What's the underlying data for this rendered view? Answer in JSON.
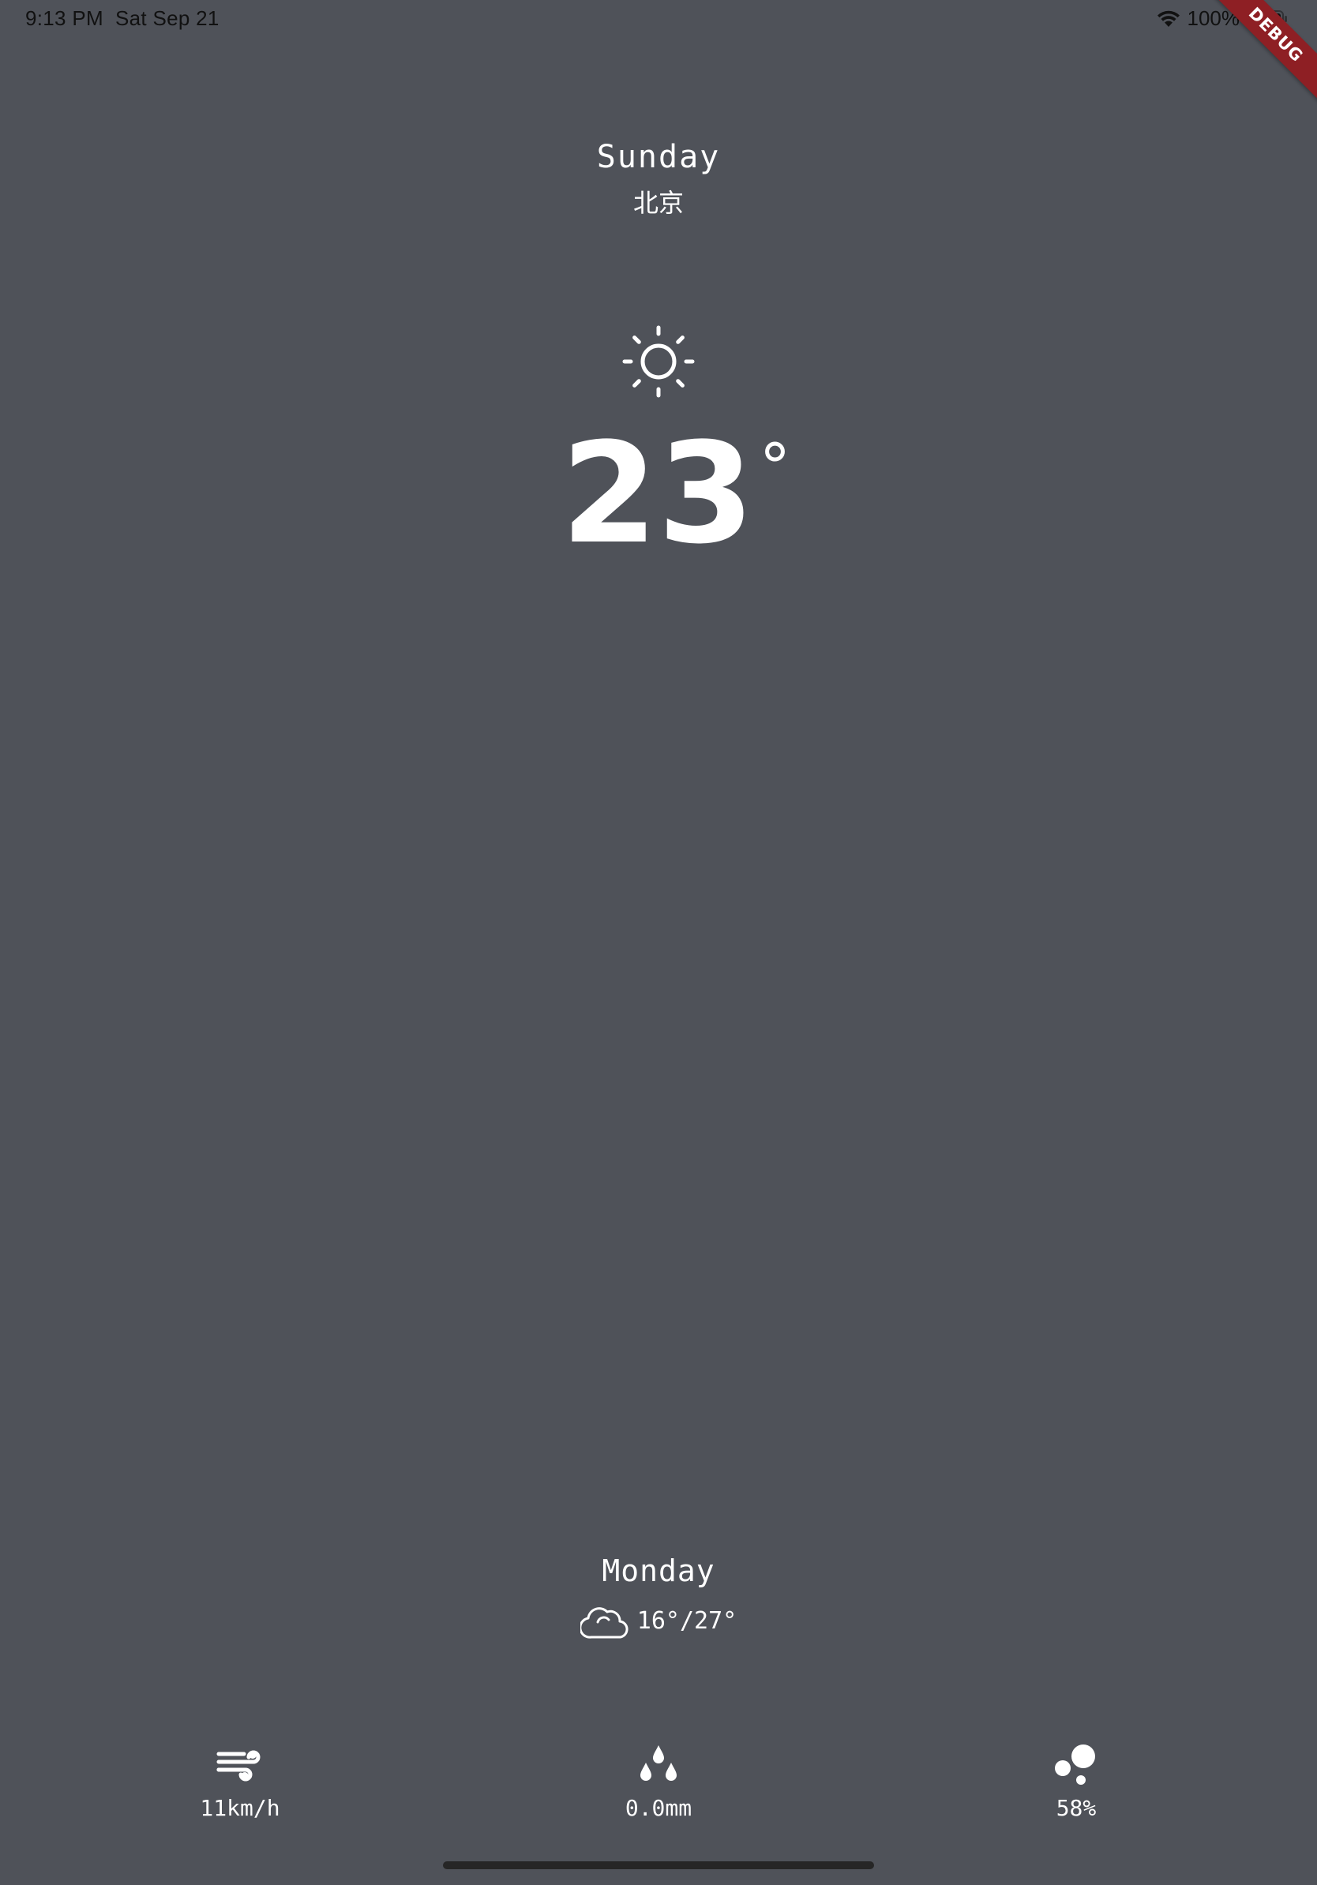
{
  "status_bar": {
    "time": "9:13 PM",
    "date": "Sat Sep 21",
    "battery": "100%",
    "wifi_icon": "wifi-icon",
    "battery_icon": "battery-full-icon"
  },
  "debug_banner": "DEBUG",
  "current": {
    "day": "Sunday",
    "city": "北京",
    "condition_icon": "sun-icon",
    "temperature": "23",
    "degree_symbol": "°"
  },
  "forecast": {
    "day": "Monday",
    "condition_icon": "cloud-icon",
    "range": "16°/27°"
  },
  "stats": {
    "wind": {
      "icon": "wind-icon",
      "value": "11km/h"
    },
    "precipitation": {
      "icon": "raindrops-icon",
      "value": "0.0mm"
    },
    "humidity": {
      "icon": "humidity-icon",
      "value": "58%"
    }
  },
  "colors": {
    "background": "#4f5259",
    "text": "#ffffff",
    "debug_banner": "#8e1f24"
  }
}
